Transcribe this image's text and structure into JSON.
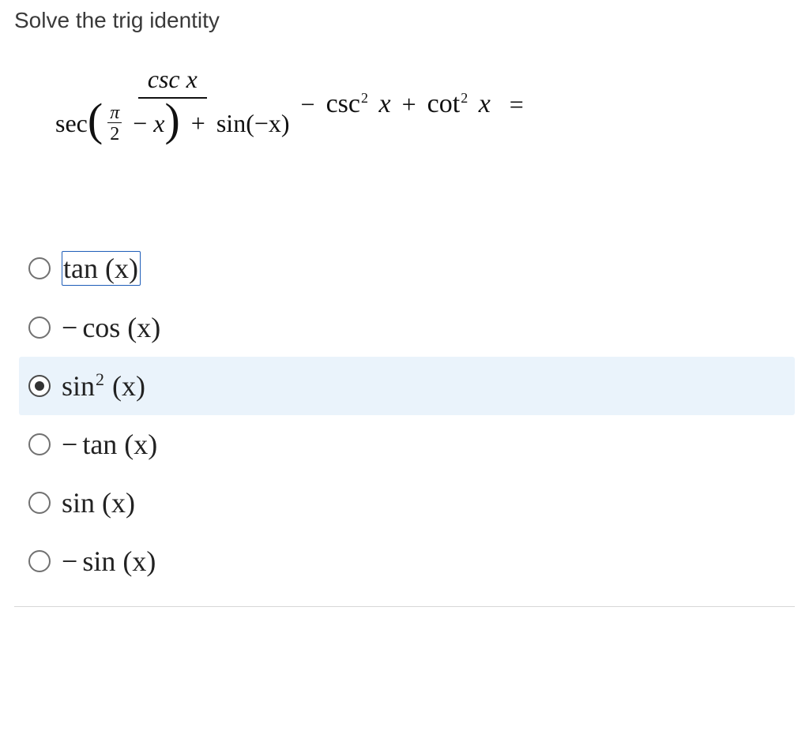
{
  "question": {
    "title": "Solve the trig identity",
    "expression": {
      "numerator": "csc x",
      "denom_left_func": "sec",
      "denom_arg_pi": "π",
      "denom_arg_two": "2",
      "denom_arg_minus": "−",
      "denom_arg_x": "x",
      "denom_plus": "+",
      "denom_right_func": "sin",
      "denom_right_arg": "(−x)",
      "after_minus": "−",
      "csc2": "csc",
      "csc2_exp": "2",
      "csc2_x": "x",
      "plus": "+",
      "cot2": "cot",
      "cot2_exp": "2",
      "cot2_x": "x",
      "equals": "="
    }
  },
  "options": [
    {
      "id": "opt-tan",
      "prefix": "",
      "text": "tan (x)",
      "sup": "",
      "selected": false,
      "focused": true
    },
    {
      "id": "opt-negcos",
      "prefix": "−",
      "text": "cos (x)",
      "sup": "",
      "selected": false,
      "focused": false
    },
    {
      "id": "opt-sin2",
      "prefix": "",
      "text": "sin",
      "sup": "2",
      "suffix": " (x)",
      "selected": true,
      "focused": false
    },
    {
      "id": "opt-negtan",
      "prefix": "−",
      "text": "tan (x)",
      "sup": "",
      "selected": false,
      "focused": false
    },
    {
      "id": "opt-sin",
      "prefix": "",
      "text": "sin (x)",
      "sup": "",
      "selected": false,
      "focused": false
    },
    {
      "id": "opt-negsin",
      "prefix": "−",
      "text": "sin (x)",
      "sup": "",
      "selected": false,
      "focused": false
    }
  ]
}
